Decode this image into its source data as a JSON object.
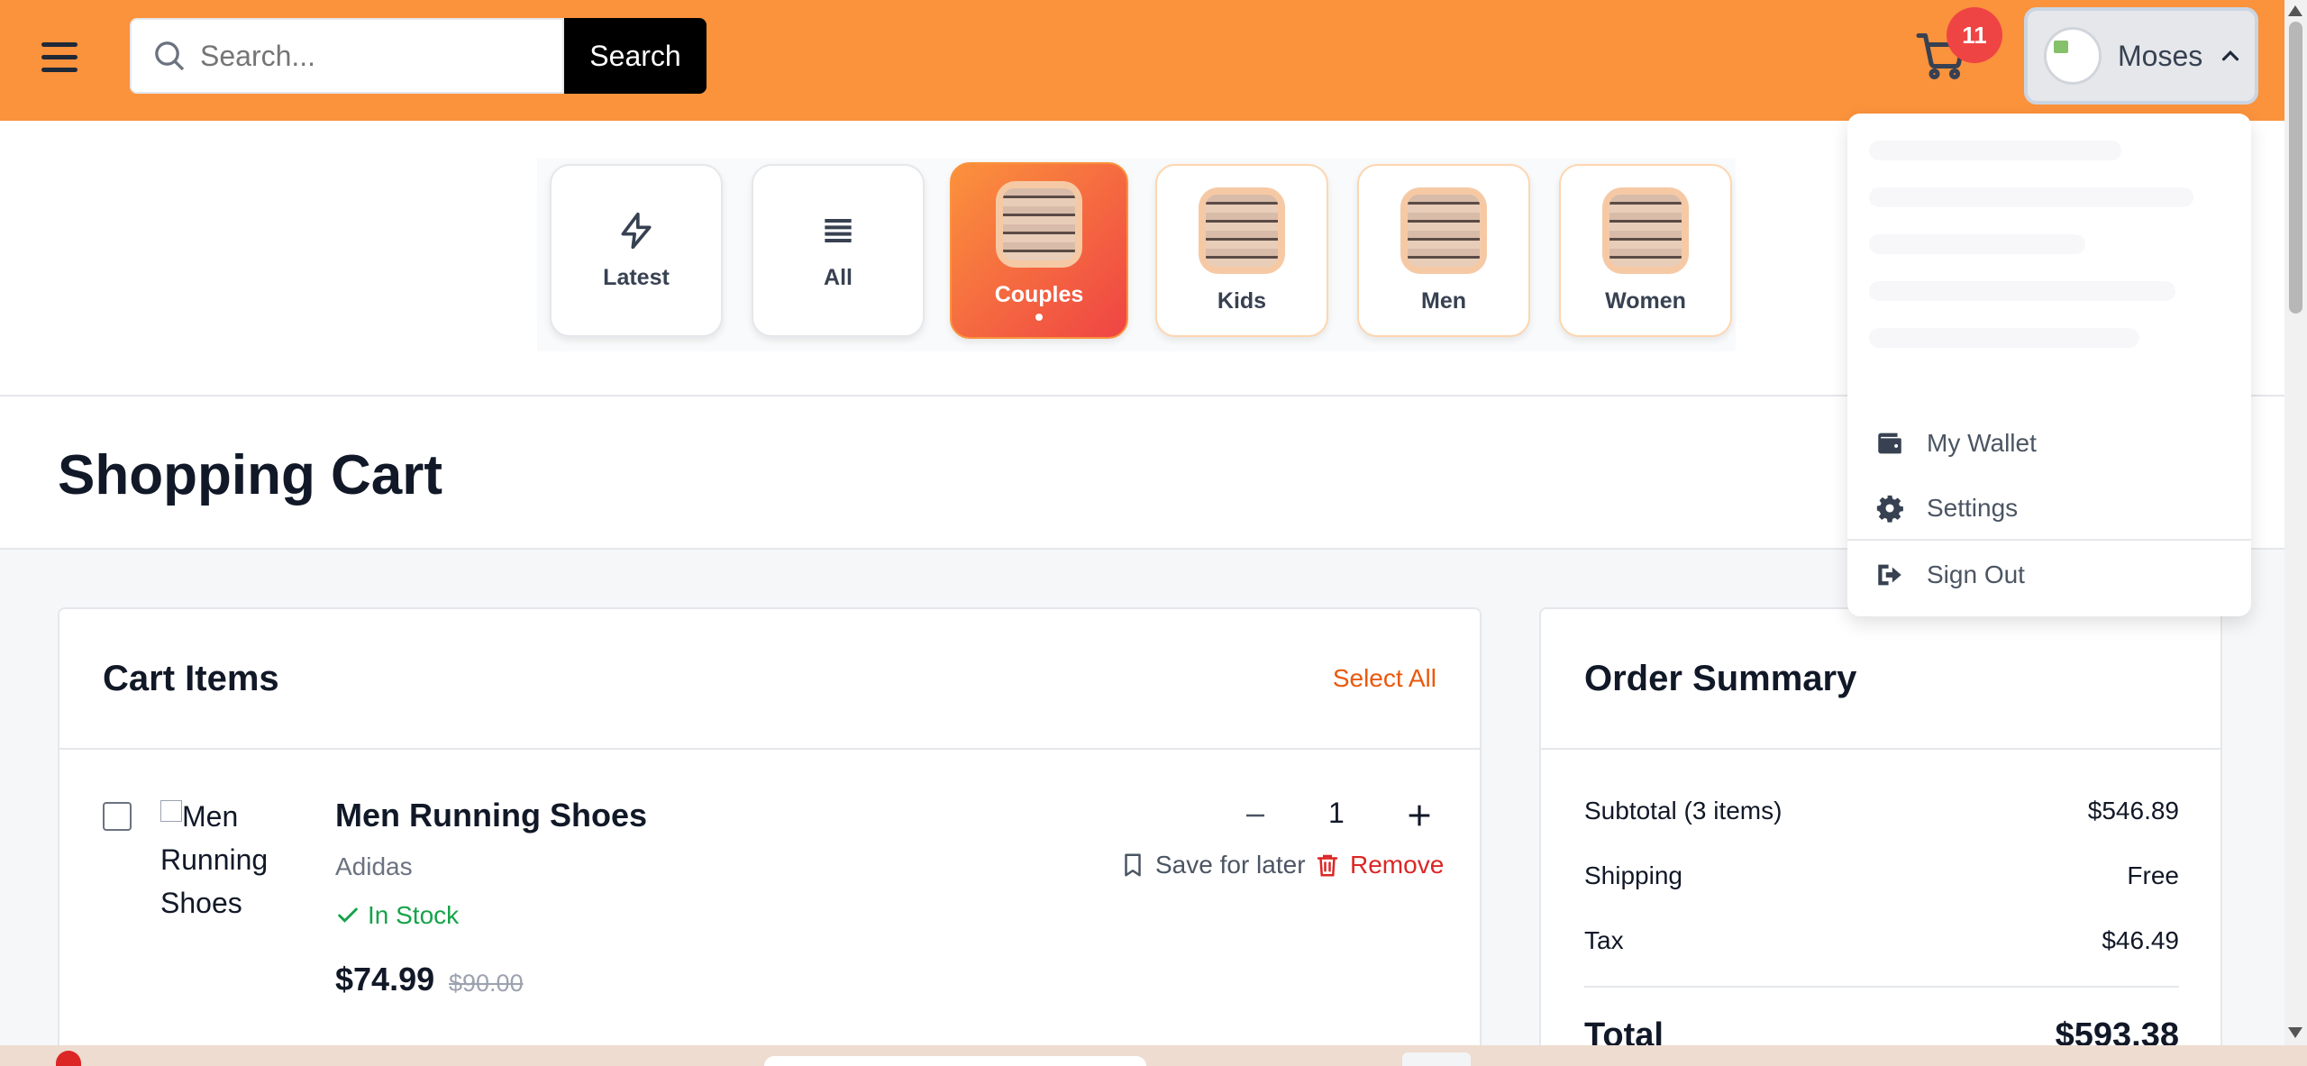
{
  "header": {
    "search_placeholder": "Search...",
    "search_button": "Search",
    "cart_count": "11",
    "user_name": "Moses"
  },
  "categories": [
    {
      "label": "Latest",
      "icon": "lightning-icon"
    },
    {
      "label": "All",
      "icon": "list-icon"
    },
    {
      "label": "Couples",
      "icon": "category-image",
      "active": true
    },
    {
      "label": "Kids",
      "icon": "category-image"
    },
    {
      "label": "Men",
      "icon": "category-image"
    },
    {
      "label": "Women",
      "icon": "category-image"
    }
  ],
  "page": {
    "title": "Shopping Cart"
  },
  "cart": {
    "title": "Cart Items",
    "select_all": "Select All",
    "items": [
      {
        "image_alt": "Men Running Shoes",
        "name": "Men Running Shoes",
        "brand": "Adidas",
        "stock": "In Stock",
        "price": "$74.99",
        "original_price": "$90.00",
        "quantity": "1",
        "save_later": "Save for later",
        "remove": "Remove"
      }
    ]
  },
  "summary": {
    "title": "Order Summary",
    "subtotal_label": "Subtotal (3 items)",
    "subtotal_value": "$546.89",
    "shipping_label": "Shipping",
    "shipping_value": "Free",
    "tax_label": "Tax",
    "tax_value": "$46.49",
    "total_label": "Total",
    "total_value": "$593.38"
  },
  "user_menu": {
    "items": [
      {
        "label": "My Wallet",
        "icon": "wallet-icon"
      },
      {
        "label": "Settings",
        "icon": "gear-icon"
      },
      {
        "label": "Sign Out",
        "icon": "sign-out-icon"
      }
    ]
  },
  "colors": {
    "header_bg": "#fb923c",
    "accent": "#ea580c",
    "danger": "#dc2626",
    "success": "#16a34a",
    "badge": "#ef4444"
  }
}
